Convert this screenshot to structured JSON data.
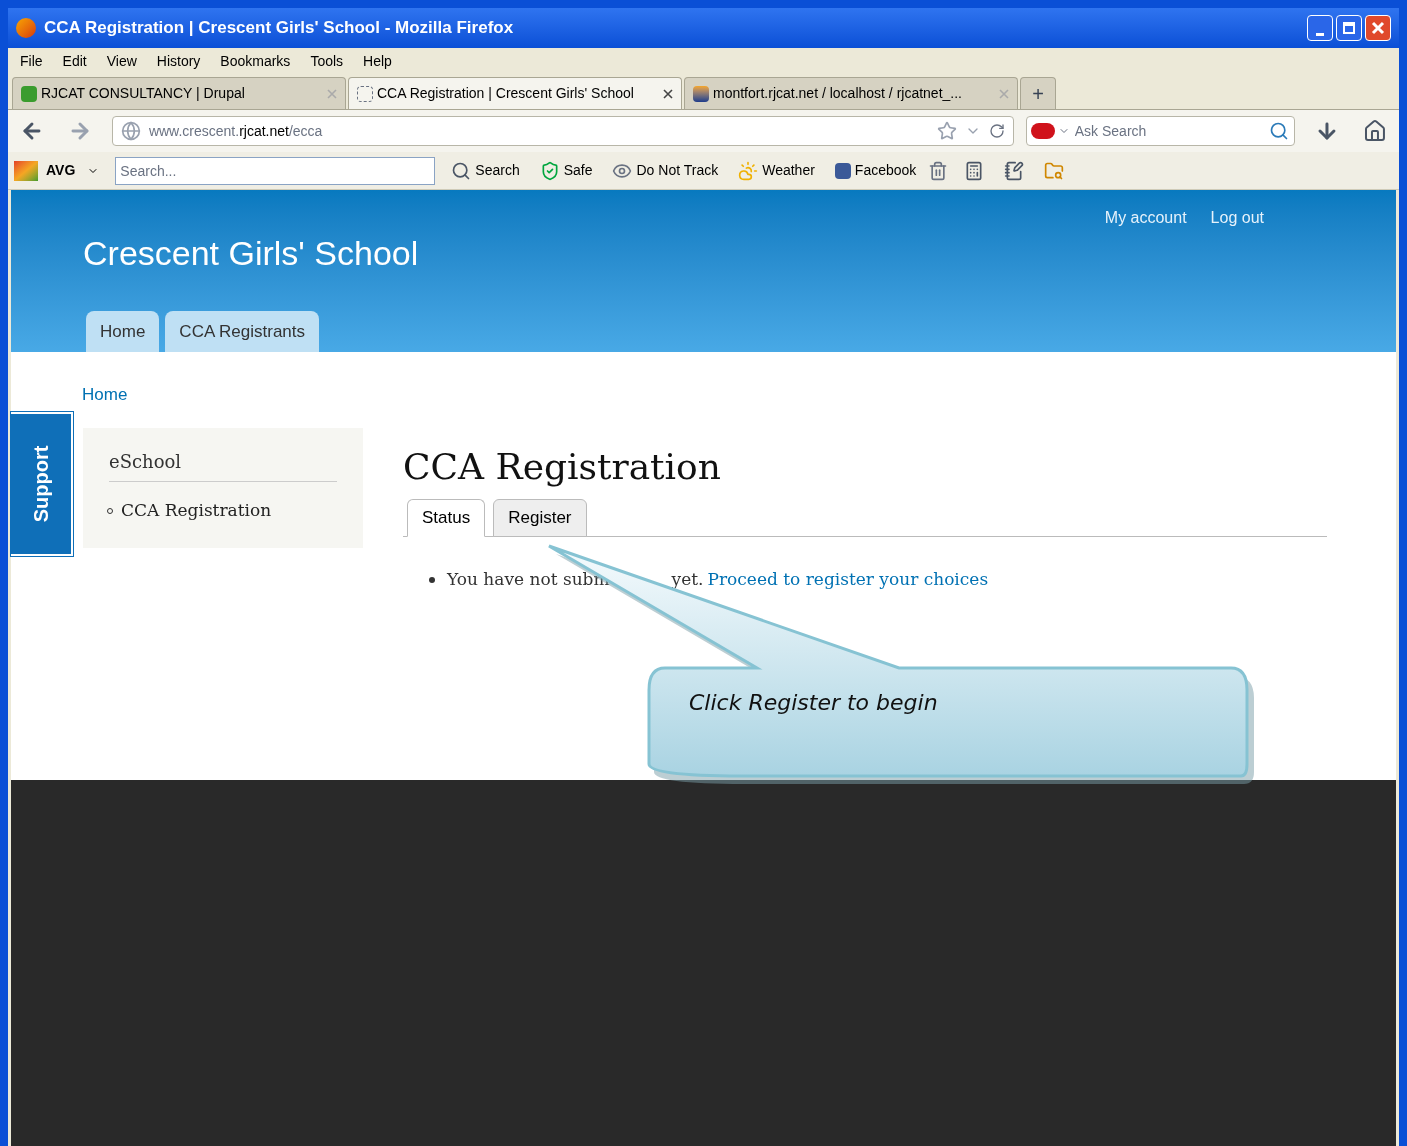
{
  "window": {
    "title": "CCA Registration | Crescent Girls' School - Mozilla Firefox"
  },
  "menu": [
    "File",
    "Edit",
    "View",
    "History",
    "Bookmarks",
    "Tools",
    "Help"
  ],
  "browser_tabs": [
    {
      "title": "RJCAT CONSULTANCY | Drupal",
      "selected": false,
      "kind": "drupal"
    },
    {
      "title": "CCA Registration | Crescent Girls' School",
      "selected": true,
      "kind": "blank"
    },
    {
      "title": "montfort.rjcat.net / localhost / rjcatnet_...",
      "selected": false,
      "kind": "pma"
    }
  ],
  "new_tab": "+",
  "address_bar": {
    "url": "www.crescent.**rjcat.net**/ecca"
  },
  "search_bar": {
    "placeholder": "Ask Search"
  },
  "toolbar": {
    "brand": "AVG",
    "search_placeholder": "Search...",
    "items": [
      "Search",
      "Safe",
      "Do Not Track",
      "Weather",
      "Facebook"
    ]
  },
  "site": {
    "name": "Crescent Girls' School",
    "user_links": [
      "My account",
      "Log out"
    ],
    "nav_tabs": [
      {
        "label": "Home",
        "selected": false
      },
      {
        "label": "CCA Registrants",
        "selected": false
      }
    ]
  },
  "breadcrumb": "Home",
  "support_tab": "Support",
  "sidebar": {
    "title": "eSchool",
    "items": [
      "CCA Registration"
    ]
  },
  "content": {
    "title": "CCA Registration",
    "tabs": [
      {
        "label": "Status",
        "selected": true
      },
      {
        "label": "Register",
        "selected": false
      }
    ],
    "message_start": "You have not subm",
    "message_end": "yet.",
    "link": "Proceed to register your choices"
  },
  "callout": {
    "text": "Click Register to begin"
  }
}
